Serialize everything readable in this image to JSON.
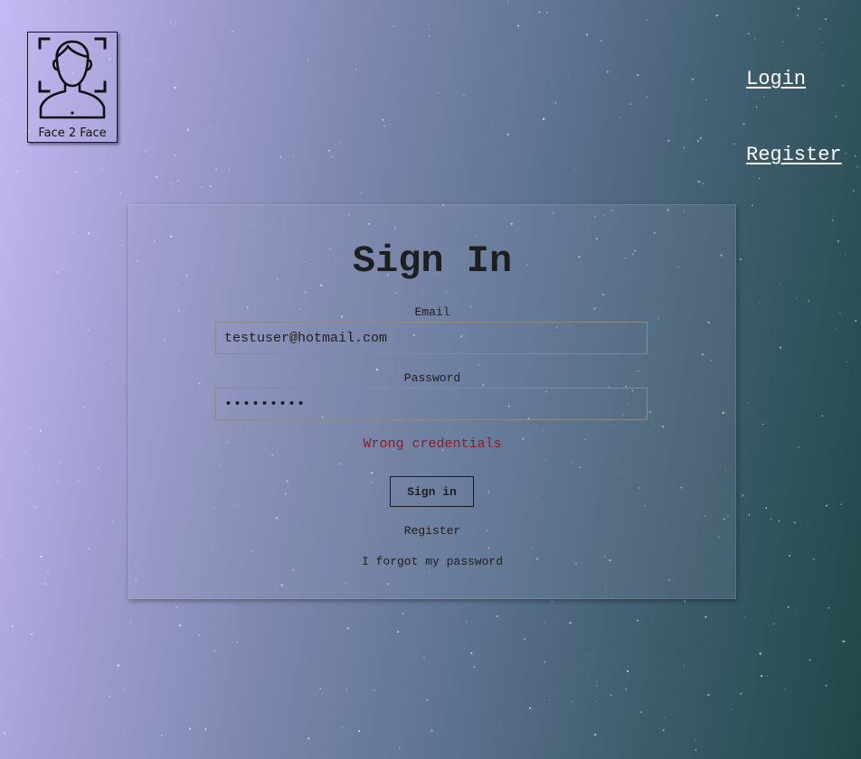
{
  "logo": {
    "icon": "face-scan-icon",
    "text": "Face 2 Face"
  },
  "nav": {
    "login": "Login",
    "register": "Register"
  },
  "signin": {
    "title": "Sign In",
    "email_label": "Email",
    "email_value": "testuser@hotmail.com",
    "password_label": "Password",
    "password_value": "123456789",
    "error": "Wrong credentials",
    "button": "Sign in",
    "register_link": "Register",
    "forgot_link": "I forgot my password"
  },
  "colors": {
    "error": "#8e1c2a",
    "nav_link": "#ffffff",
    "text": "#1e1e1e"
  }
}
